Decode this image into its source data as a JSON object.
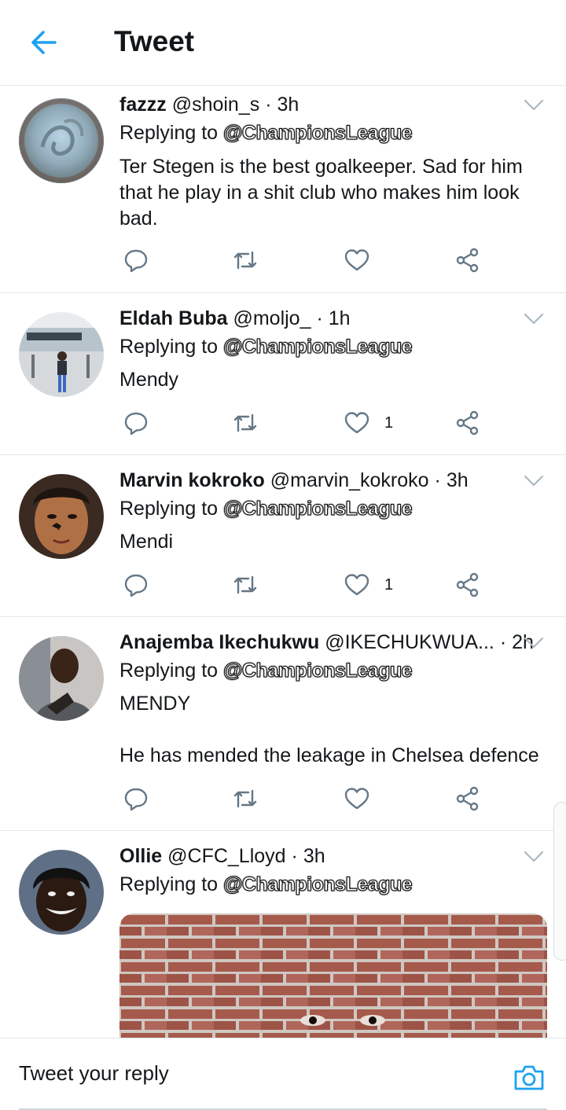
{
  "header": {
    "title": "Tweet"
  },
  "tweets": [
    {
      "name": "fazzz",
      "handle": "@shoin_s",
      "time": "3h",
      "replying_prefix": "Replying to",
      "replying_to": "@ChampionsLeague",
      "text_lines": [
        "Ter Stegen is the best goalkeeper. Sad for him",
        "that he play in a shit club who makes him look",
        "bad."
      ],
      "likes": ""
    },
    {
      "name": "Eldah Buba",
      "handle": "@moljo_",
      "time": "1h",
      "replying_prefix": "Replying to",
      "replying_to": "@ChampionsLeague",
      "text_lines": [
        "Mendy"
      ],
      "likes": "1"
    },
    {
      "name": "Marvin kokroko",
      "handle": "@marvin_kokroko",
      "time": "3h",
      "replying_prefix": "Replying to",
      "replying_to": "@ChampionsLeague",
      "text_lines": [
        "Mendi"
      ],
      "likes": "1"
    },
    {
      "name": "Anajemba Ikechukwu",
      "handle": "@IKECHUKWUA...",
      "time": "2h",
      "replying_prefix": "Replying to",
      "replying_to": "@ChampionsLeague",
      "text_lines": [
        "MENDY",
        "",
        "He has mended the leakage in Chelsea defence"
      ],
      "likes": ""
    },
    {
      "name": "Ollie",
      "handle": "@CFC_Lloyd",
      "time": "3h",
      "replying_prefix": "Replying to",
      "replying_to": "@ChampionsLeague",
      "text_lines": [],
      "likes": ""
    }
  ],
  "reply_bar": {
    "placeholder": "Tweet your reply"
  },
  "icons": {
    "back": "arrow-left-icon",
    "chevron": "chevron-down-icon",
    "reply": "reply-icon",
    "retweet": "retweet-icon",
    "like": "heart-icon",
    "share": "share-icon",
    "camera": "camera-icon"
  },
  "colors": {
    "accent": "#1da1f2",
    "icon_gray": "#657786",
    "divider": "#e1e8ed"
  }
}
